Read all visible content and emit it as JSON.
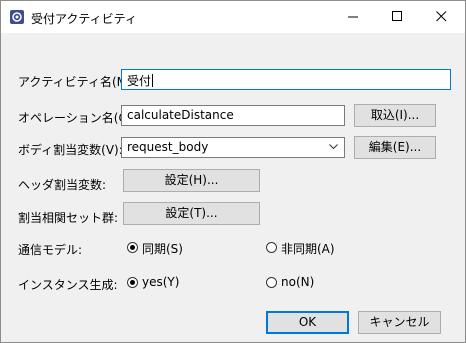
{
  "window": {
    "title": "受付アクティビティ",
    "icon": "app-gear-icon",
    "controls": {
      "minimize": "minimize-icon",
      "maximize": "maximize-icon",
      "close": "close-icon"
    }
  },
  "form": {
    "activity_name": {
      "label": "アクティビティ名(M):",
      "value": "受付"
    },
    "operation_name": {
      "label": "オペレーション名(O):",
      "value": "calculateDistance",
      "import_button": "取込(I)..."
    },
    "body_variable": {
      "label": "ボディ割当変数(V):",
      "value": "request_body",
      "edit_button": "編集(E)..."
    },
    "header_variable": {
      "label": "ヘッダ割当変数:",
      "button": "設定(H)..."
    },
    "correlation_set": {
      "label": "割当相関セット群:",
      "button": "設定(T)..."
    },
    "comm_model": {
      "label": "通信モデル:",
      "options": [
        "同期(S)",
        "非同期(A)"
      ],
      "selected": "同期(S)"
    },
    "instance_creation": {
      "label": "インスタンス生成:",
      "options": [
        "yes(Y)",
        "no(N)"
      ],
      "selected": "yes(Y)"
    }
  },
  "footer": {
    "ok": "OK",
    "cancel": "キャンセル"
  }
}
